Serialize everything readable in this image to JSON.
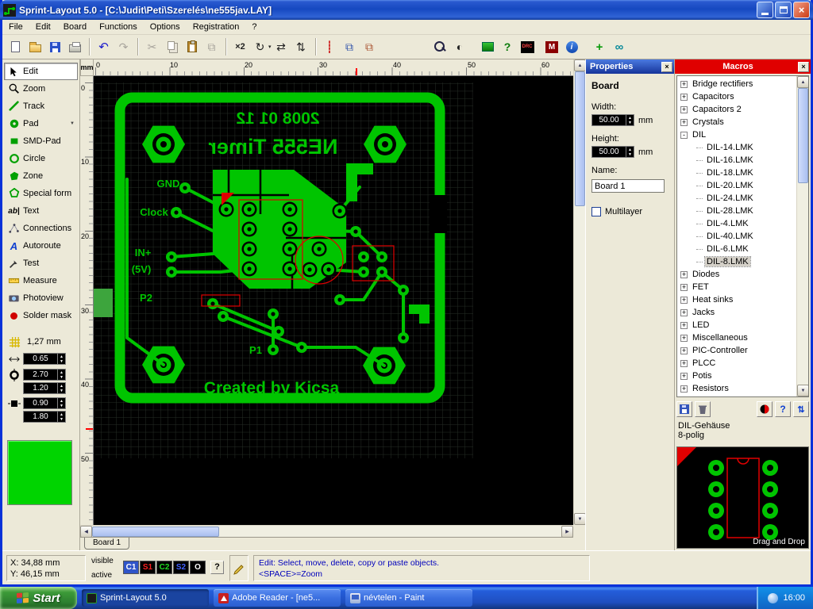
{
  "titlebar": {
    "title": "Sprint-Layout 5.0 - [C:\\Judit\\Peti\\Szerelés\\ne555jav.LAY]",
    "close_glyph": "×"
  },
  "menu": {
    "items": [
      "File",
      "Edit",
      "Board",
      "Functions",
      "Options",
      "Registration",
      "?"
    ]
  },
  "toolbar": {
    "buttons": [
      {
        "name": "new",
        "glyph": ""
      },
      {
        "name": "open",
        "glyph": ""
      },
      {
        "name": "save",
        "glyph": ""
      },
      {
        "name": "print",
        "glyph": ""
      },
      {
        "name": "undo",
        "glyph": "↶"
      },
      {
        "name": "redo",
        "glyph": "↷"
      },
      {
        "name": "cut",
        "glyph": "✂"
      },
      {
        "name": "copy",
        "glyph": ""
      },
      {
        "name": "paste",
        "glyph": ""
      },
      {
        "name": "duplicate",
        "glyph": "⧉"
      },
      {
        "name": "scale-x2",
        "glyph": "×2"
      },
      {
        "name": "rotate",
        "glyph": "↻"
      },
      {
        "name": "mirror-horizontal",
        "glyph": "⇄"
      },
      {
        "name": "mirror-vertical",
        "glyph": "⇅"
      },
      {
        "name": "guides",
        "glyph": "┊"
      },
      {
        "name": "bring-to-front",
        "glyph": "⧉"
      },
      {
        "name": "send-to-back",
        "glyph": "⧉"
      },
      {
        "name": "zoom",
        "glyph": ""
      },
      {
        "name": "gamma",
        "glyph": "◐"
      },
      {
        "name": "photoview",
        "glyph": ""
      },
      {
        "name": "help-drc",
        "glyph": "?"
      },
      {
        "name": "drc",
        "glyph": "DRC"
      },
      {
        "name": "macros",
        "glyph": "M"
      },
      {
        "name": "info",
        "glyph": "i"
      },
      {
        "name": "wizard",
        "glyph": "+"
      },
      {
        "name": "connections",
        "glyph": "∞"
      }
    ],
    "rotate_dropdown_glyph": "▾"
  },
  "tools": {
    "items": [
      {
        "label": "Edit"
      },
      {
        "label": "Zoom"
      },
      {
        "label": "Track"
      },
      {
        "label": "Pad"
      },
      {
        "label": "SMD-Pad"
      },
      {
        "label": "Circle"
      },
      {
        "label": "Zone"
      },
      {
        "label": "Special form"
      },
      {
        "label": "Text"
      },
      {
        "label": "Connections"
      },
      {
        "label": "Autoroute"
      },
      {
        "label": "Test"
      },
      {
        "label": "Measure"
      },
      {
        "label": "Photoview"
      },
      {
        "label": "Solder mask"
      }
    ],
    "pad_dropdown_glyph": "▼",
    "text_icon_glyph": "ab|",
    "autoroute_icon_glyph": "A"
  },
  "grid": {
    "value": "1,27 mm"
  },
  "params": {
    "track_width": "0.65",
    "pad_diameter": "2.70",
    "pad_drill": "1.20",
    "smd_width": "0.90",
    "smd_height": "1.80"
  },
  "rulers": {
    "unit": "mm",
    "top_ticks": [
      "0",
      "10",
      "20",
      "30",
      "40",
      "50",
      "60"
    ],
    "left_ticks": [
      "0",
      "10",
      "20",
      "30",
      "40",
      "50"
    ]
  },
  "board": {
    "copper_color": "#00c400",
    "outline_color": "#e00000",
    "texts": {
      "date": "2008 01 12",
      "title": "NE555 Timer",
      "gnd": "GND",
      "clock": "Clock",
      "in_plus": "IN+",
      "in_voltage": "(5V)",
      "p2": "P2",
      "p1": "P1",
      "credit": "Created by Kicsa"
    }
  },
  "properties": {
    "title": "Properties",
    "section": "Board",
    "width_label": "Width:",
    "width_value": "50.00",
    "width_unit": "mm",
    "height_label": "Height:",
    "height_value": "50.00",
    "height_unit": "mm",
    "name_label": "Name:",
    "name_value": "Board 1",
    "multilayer_label": "Multilayer"
  },
  "macros": {
    "title": "Macros",
    "tree": [
      {
        "glyph": "+",
        "label": "Bridge rectifiers"
      },
      {
        "glyph": "+",
        "label": "Capacitors"
      },
      {
        "glyph": "+",
        "label": "Capacitors 2"
      },
      {
        "glyph": "+",
        "label": "Crystals"
      },
      {
        "glyph": "-",
        "label": "DIL"
      },
      {
        "glyph": "",
        "label": "DIL-14.LMK"
      },
      {
        "glyph": "",
        "label": "DIL-16.LMK"
      },
      {
        "glyph": "",
        "label": "DIL-18.LMK"
      },
      {
        "glyph": "",
        "label": "DIL-20.LMK"
      },
      {
        "glyph": "",
        "label": "DIL-24.LMK"
      },
      {
        "glyph": "",
        "label": "DIL-28.LMK"
      },
      {
        "glyph": "",
        "label": "DIL-4.LMK"
      },
      {
        "glyph": "",
        "label": "DIL-40.LMK"
      },
      {
        "glyph": "",
        "label": "DIL-6.LMK"
      },
      {
        "glyph": "",
        "label": "DIL-8.LMK",
        "selected": true
      },
      {
        "glyph": "+",
        "label": "Diodes"
      },
      {
        "glyph": "+",
        "label": "FET"
      },
      {
        "glyph": "+",
        "label": "Heat sinks"
      },
      {
        "glyph": "+",
        "label": "Jacks"
      },
      {
        "glyph": "+",
        "label": "LED"
      },
      {
        "glyph": "+",
        "label": "Miscellaneous"
      },
      {
        "glyph": "+",
        "label": "PIC-Controller"
      },
      {
        "glyph": "+",
        "label": "PLCC"
      },
      {
        "glyph": "+",
        "label": "Potis"
      },
      {
        "glyph": "+",
        "label": "Resistors"
      }
    ],
    "panel_help_glyph": "?",
    "panel_sort_glyph": "⇅",
    "info_line1": "DIL-Gehäuse",
    "info_line2": "8-polig",
    "dragdrop_hint": "Drag and Drop"
  },
  "document": {
    "tab": "Board 1"
  },
  "statusbar": {
    "x_label": "X:",
    "x_value": "34,88 mm",
    "y_label": "Y:",
    "y_value": "46,15 mm",
    "visible_label": "visible",
    "active_label": "active",
    "layers": [
      {
        "label": "C1",
        "color": "#ffffff",
        "bg": "#2f54c8"
      },
      {
        "label": "S1",
        "color": "#ff2020",
        "bg": "#000000"
      },
      {
        "label": "C2",
        "color": "#20dd20",
        "bg": "#000000"
      },
      {
        "label": "S2",
        "color": "#4060ff",
        "bg": "#000000"
      },
      {
        "label": "O",
        "color": "#ffffff",
        "bg": "#000000"
      }
    ],
    "help_glyph": "?",
    "message_line1": "Edit: Select, move, delete, copy or paste objects.",
    "message_line2": "<SPACE>=Zoom"
  },
  "taskbar": {
    "start_label": "Start",
    "apps": [
      {
        "label": "Sprint-Layout 5.0",
        "active": true
      },
      {
        "label": "Adobe Reader - [ne5...",
        "active": false
      },
      {
        "label": "névtelen - Paint",
        "active": false
      }
    ],
    "clock": "16:00"
  },
  "ui": {
    "spin_up": "▲",
    "spin_down": "▼",
    "scroll_up": "▲",
    "scroll_down": "▼",
    "scroll_left": "◀",
    "scroll_right": "▶"
  }
}
